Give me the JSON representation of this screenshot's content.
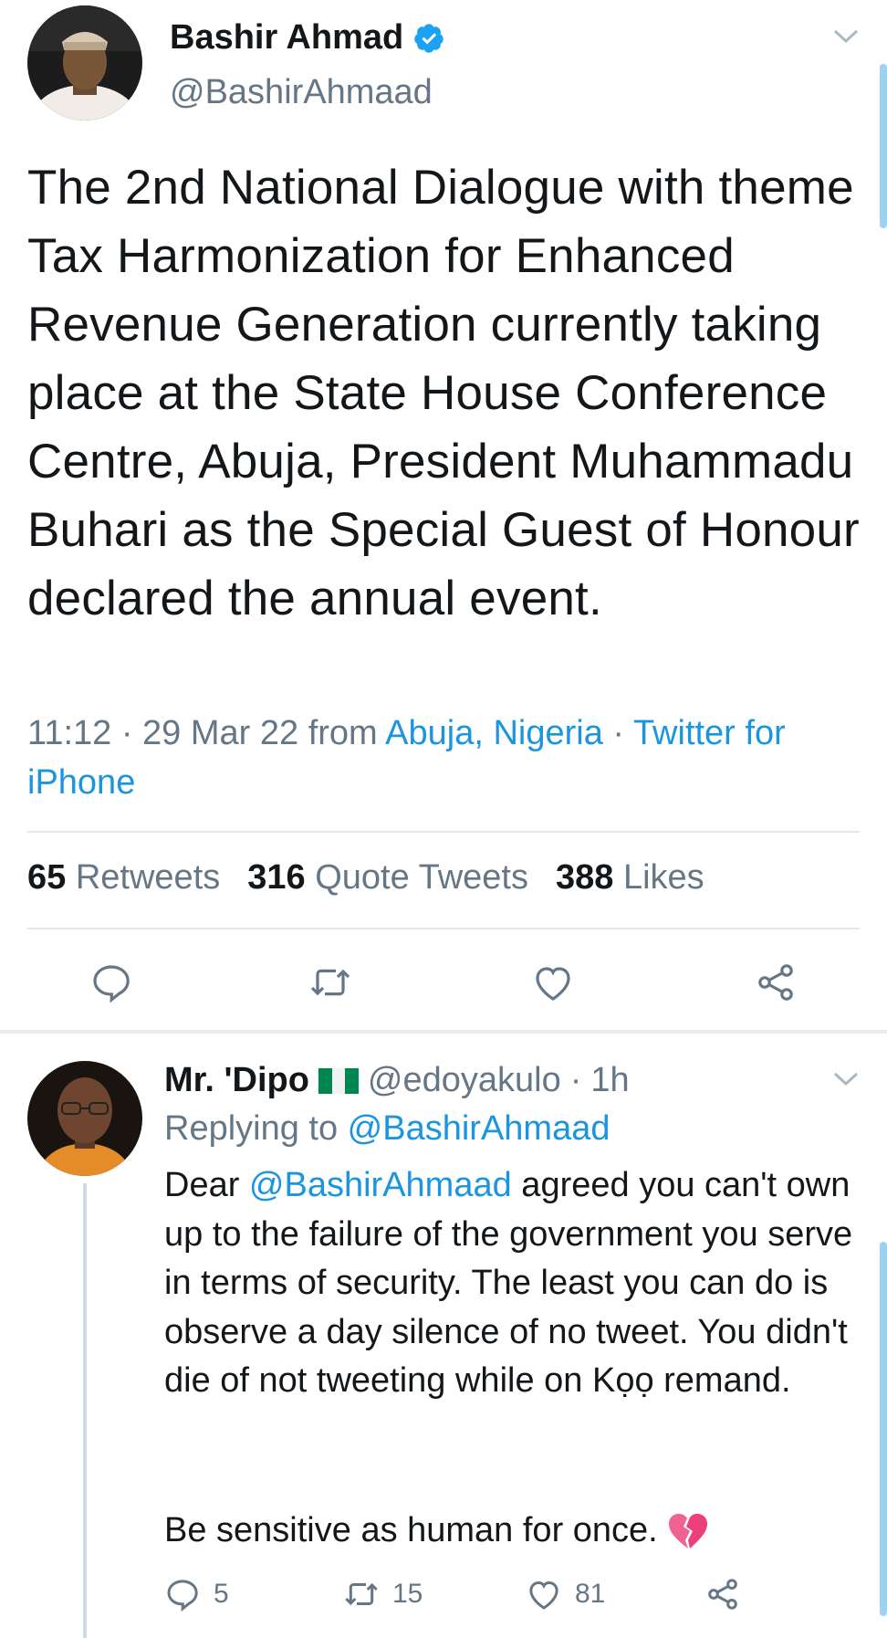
{
  "main_tweet": {
    "author_name": "Bashir Ahmad",
    "author_handle": "@BashirAhmaad",
    "text": "The 2nd National Dialogue with theme Tax Harmonization for Enhanced Revenue Generation currently taking place at the State House Conference Centre, Abuja, President Muhammadu Buhari as the Special Guest of Honour declared the annual event.",
    "time": "11:12 · 29 Mar 22 from ",
    "location": "Abuja, Nigeria",
    "sep": " · ",
    "source": "Twitter for iPhone",
    "stats": {
      "retweets_count": "65",
      "retweets_label": "Retweets",
      "quotes_count": "316",
      "quotes_label": "Quote Tweets",
      "likes_count": "388",
      "likes_label": "Likes"
    }
  },
  "reply_tweet": {
    "author_name": "Mr. 'Dipo",
    "author_handle": "@edoyakulo",
    "time_sep": "·",
    "time": "1h",
    "replying_label": "Replying to ",
    "replying_handle": "@BashirAhmaad",
    "text_prefix": "Dear ",
    "text_mention": "@BashirAhmaad",
    "text_body": " agreed you can't own up to the failure of the government you serve in terms of security. The least you can do is observe a day silence of no tweet. You didn't die of not tweeting while on Kọọ remand.",
    "text_para2": "Be sensitive as human for once.",
    "reply_count": "5",
    "retweet_count": "15",
    "like_count": "81"
  },
  "colors": {
    "link": "#1b95e0",
    "muted": "#657786",
    "text": "#14171a",
    "verified": "#1da1f2"
  },
  "icons": [
    "verified-badge-icon",
    "chevron-down-icon",
    "reply-icon",
    "retweet-icon",
    "like-icon",
    "share-icon",
    "nigeria-flag-icon",
    "broken-heart-emoji"
  ]
}
